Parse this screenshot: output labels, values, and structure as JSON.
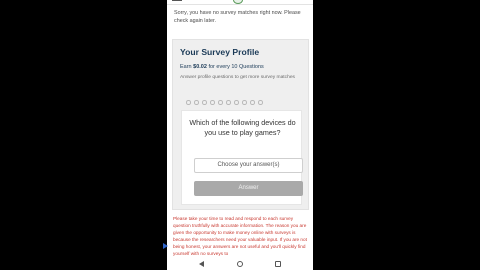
{
  "header": {
    "menu_icon": "hamburger-icon",
    "logo_icon": "brand-logo-icon"
  },
  "notice": {
    "no_matches": "Sorry, you have no survey matches right now. Please check again later."
  },
  "profile": {
    "title": "Your Survey Profile",
    "earn_prefix": "Earn",
    "earn_amount": "$0.02",
    "earn_suffix": "for every 10 Questions",
    "description": "Answer profile questions to get more survey matches",
    "progress_total": 10,
    "progress_completed": 0
  },
  "question": {
    "text": "Which of the following devices do you use to play games?",
    "select_label": "Choose your answer(s)",
    "answer_button": "Answer"
  },
  "warning": {
    "text": "Please take your time to read and respond to each survey question truthfully with accurate information. The reason you are given the opportunity to make money online with surveys is because the researchers need your valuable input. If you are not being honest, your answers are not useful and you'll quickly find yourself with no surveys to"
  },
  "navbar": {
    "back_icon": "back-triangle-icon",
    "home_icon": "home-circle-icon",
    "recent_icon": "recent-apps-icon"
  },
  "colors": {
    "title": "#1b3a57",
    "warning": "#c8382f",
    "button_disabled": "#a9a9a9",
    "card_bg": "#efefef"
  }
}
